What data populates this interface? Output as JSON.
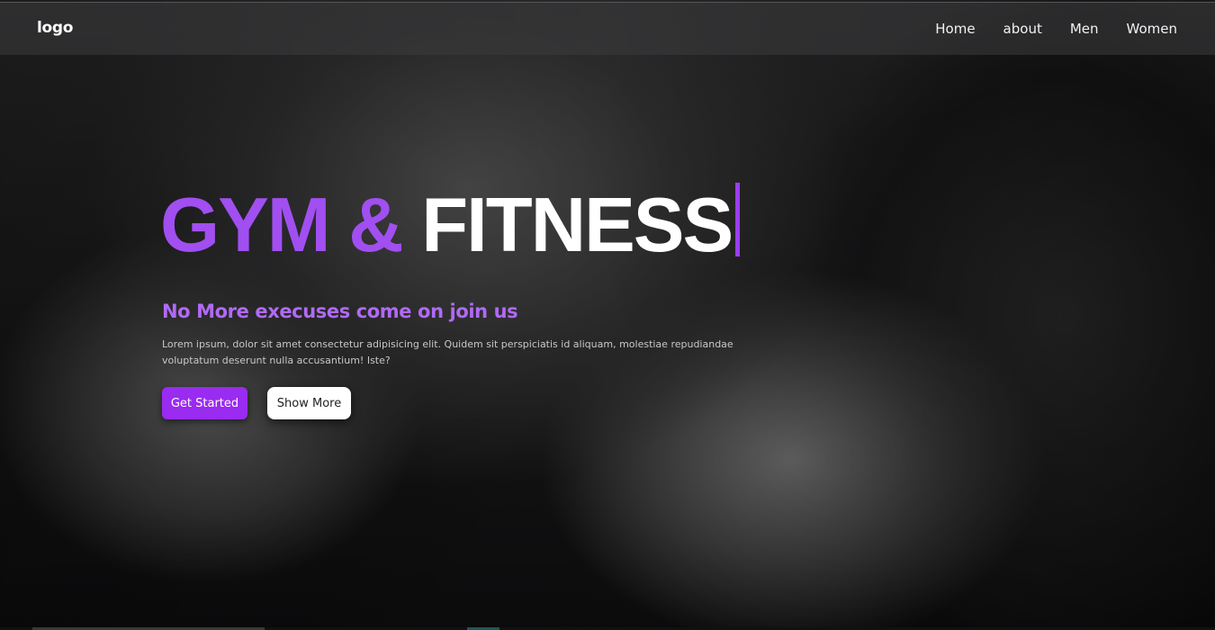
{
  "header": {
    "logo": "logo",
    "nav": [
      "Home",
      "about",
      "Men",
      "Women"
    ]
  },
  "hero": {
    "title_part1": "GYM & ",
    "title_part2": "FITNESS",
    "subtitle": "No More execuses come on join us",
    "paragraph": "Lorem ipsum, dolor sit amet consectetur adipisicing elit. Quidem sit perspiciatis id aliquam, molestiae repudiandae voluptatum deserunt nulla accusantium! Iste?",
    "primary_button": "Get Started",
    "secondary_button": "Show More"
  },
  "colors": {
    "accent": "#a14ff0",
    "button_primary": "#9a2bf0",
    "subtitle": "#b06af5"
  }
}
